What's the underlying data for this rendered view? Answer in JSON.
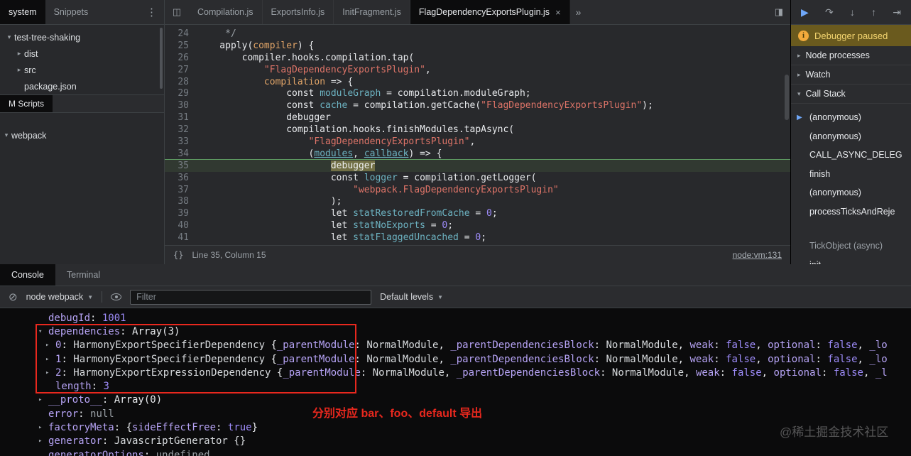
{
  "colors": {
    "annotation_red": "#e8281e",
    "accent_blue": "#6fa7f9",
    "paused_banner_bg": "#6a5a1e",
    "paused_banner_text": "#f4d570"
  },
  "left_pane": {
    "tabs": [
      {
        "label": "system",
        "active": true
      },
      {
        "label": "Snippets",
        "active": false
      }
    ],
    "tree": [
      {
        "label": "test-tree-shaking",
        "depth": 0,
        "expander": "down"
      },
      {
        "label": "dist",
        "depth": 1,
        "expander": "right"
      },
      {
        "label": "src",
        "depth": 1,
        "expander": "right"
      },
      {
        "label": "package.json",
        "depth": 1,
        "expander": "none"
      }
    ],
    "vm_scripts_header": "M Scripts",
    "vm_tree": [
      {
        "label": "webpack",
        "expander": "down"
      }
    ]
  },
  "editor": {
    "tabs": [
      {
        "label": "Compilation.js",
        "active": false
      },
      {
        "label": "ExportsInfo.js",
        "active": false
      },
      {
        "label": "InitFragment.js",
        "active": false
      },
      {
        "label": "FlagDependencyExportsPlugin.js",
        "active": true,
        "closable": true
      }
    ],
    "paused_line": 35,
    "status": {
      "format_icon": "{}",
      "position": "Line 35, Column 15",
      "source_link": "node:vm:131"
    },
    "code": [
      {
        "num": 24,
        "segs": [
          [
            "cmt",
            "     */"
          ]
        ]
      },
      {
        "num": 25,
        "segs": [
          [
            "pl",
            "    apply("
          ],
          [
            "def",
            "compiler"
          ],
          [
            "pl",
            ") {"
          ]
        ]
      },
      {
        "num": 26,
        "segs": [
          [
            "pl",
            "        compiler.hooks.compilation.tap("
          ]
        ]
      },
      {
        "num": 27,
        "segs": [
          [
            "str",
            "            \"FlagDependencyExportsPlugin\""
          ],
          [
            "pl",
            ","
          ]
        ]
      },
      {
        "num": 28,
        "segs": [
          [
            "pl",
            "            "
          ],
          [
            "def",
            "compilation"
          ],
          [
            "pl",
            " => {"
          ]
        ]
      },
      {
        "num": 29,
        "segs": [
          [
            "pl",
            "                const "
          ],
          [
            "var",
            "moduleGraph"
          ],
          [
            "pl",
            " = compilation.moduleGraph;"
          ]
        ]
      },
      {
        "num": 30,
        "segs": [
          [
            "pl",
            "                const "
          ],
          [
            "var",
            "cache"
          ],
          [
            "pl",
            " = compilation.getCache("
          ],
          [
            "str",
            "\"FlagDependencyExportsPlugin\""
          ],
          [
            "pl",
            ");"
          ]
        ]
      },
      {
        "num": 31,
        "segs": [
          [
            "pl",
            "                debugger"
          ]
        ]
      },
      {
        "num": 32,
        "segs": [
          [
            "pl",
            "                compilation.hooks.finishModules.tapAsync("
          ]
        ]
      },
      {
        "num": 33,
        "segs": [
          [
            "str",
            "                    \"FlagDependencyExportsPlugin\""
          ],
          [
            "pl",
            ","
          ]
        ]
      },
      {
        "num": 34,
        "segs": [
          [
            "pl",
            "                    ("
          ],
          [
            "varu",
            "modules"
          ],
          [
            "pl",
            ", "
          ],
          [
            "varu",
            "callback"
          ],
          [
            "pl",
            ") => {"
          ]
        ]
      },
      {
        "num": 35,
        "segs": [
          [
            "pl",
            "                        "
          ],
          [
            "dbg",
            "debugger"
          ]
        ]
      },
      {
        "num": 36,
        "segs": [
          [
            "pl",
            "                        const "
          ],
          [
            "var",
            "logger"
          ],
          [
            "pl",
            " = compilation.getLogger("
          ]
        ]
      },
      {
        "num": 37,
        "segs": [
          [
            "str",
            "                            \"webpack.FlagDependencyExportsPlugin\""
          ]
        ]
      },
      {
        "num": 38,
        "segs": [
          [
            "pl",
            "                        );"
          ]
        ]
      },
      {
        "num": 39,
        "segs": [
          [
            "pl",
            "                        let "
          ],
          [
            "var",
            "statRestoredFromCache"
          ],
          [
            "pl",
            " = "
          ],
          [
            "num",
            "0"
          ],
          [
            "pl",
            ";"
          ]
        ]
      },
      {
        "num": 40,
        "segs": [
          [
            "pl",
            "                        let "
          ],
          [
            "var",
            "statNoExports"
          ],
          [
            "pl",
            " = "
          ],
          [
            "num",
            "0"
          ],
          [
            "pl",
            ";"
          ]
        ]
      },
      {
        "num": 41,
        "segs": [
          [
            "pl",
            "                        let "
          ],
          [
            "var",
            "statFlaggedUncached"
          ],
          [
            "pl",
            " = "
          ],
          [
            "num",
            "0"
          ],
          [
            "pl",
            ";"
          ]
        ]
      }
    ]
  },
  "debugger_panel": {
    "controls": [
      "resume",
      "step-over",
      "step-into",
      "step-out",
      "step"
    ],
    "paused_banner": "Debugger paused",
    "sections": [
      {
        "label": "Node processes",
        "expanded": false
      },
      {
        "label": "Watch",
        "expanded": false
      },
      {
        "label": "Call Stack",
        "expanded": true
      }
    ],
    "call_stack": [
      {
        "label": "(anonymous)",
        "current": true
      },
      {
        "label": "(anonymous)"
      },
      {
        "label": "CALL_ASYNC_DELEG"
      },
      {
        "label": "finish"
      },
      {
        "label": "(anonymous)"
      },
      {
        "label": "processTicksAndReje"
      },
      {
        "label": "TickObject (async)",
        "async": true
      },
      {
        "label": "init"
      }
    ]
  },
  "console": {
    "tabs": [
      {
        "label": "Console",
        "active": true
      },
      {
        "label": "Terminal",
        "active": false
      }
    ],
    "toolbar": {
      "context_select": "node webpack",
      "filter_placeholder": "Filter",
      "levels_select": "Default levels"
    },
    "rows": [
      {
        "indent": 1,
        "arrow": "none",
        "segs": [
          [
            "key",
            "debugId"
          ],
          [
            "pl",
            ": "
          ],
          [
            "num",
            "1001"
          ]
        ]
      },
      {
        "indent": 1,
        "arrow": "down",
        "segs": [
          [
            "key",
            "dependencies"
          ],
          [
            "pl",
            ": "
          ],
          [
            "pl",
            "Array(3)"
          ]
        ]
      },
      {
        "indent": 2,
        "arrow": "right",
        "segs": [
          [
            "key",
            "0"
          ],
          [
            "pl",
            ": "
          ],
          [
            "cls",
            "HarmonyExportSpecifierDependency"
          ],
          [
            "pl",
            " {"
          ],
          [
            "key",
            "_parentModule"
          ],
          [
            "pl",
            ": "
          ],
          [
            "cls",
            "NormalModule"
          ],
          [
            "pl",
            ", "
          ],
          [
            "key",
            "_parentDependenciesBlock"
          ],
          [
            "pl",
            ": "
          ],
          [
            "cls",
            "NormalModule"
          ],
          [
            "pl",
            ", "
          ],
          [
            "key",
            "weak"
          ],
          [
            "pl",
            ": "
          ],
          [
            "num",
            "false"
          ],
          [
            "pl",
            ", "
          ],
          [
            "key",
            "optional"
          ],
          [
            "pl",
            ": "
          ],
          [
            "num",
            "false"
          ],
          [
            "pl",
            ", "
          ],
          [
            "key",
            "_lo"
          ]
        ]
      },
      {
        "indent": 2,
        "arrow": "right",
        "segs": [
          [
            "key",
            "1"
          ],
          [
            "pl",
            ": "
          ],
          [
            "cls",
            "HarmonyExportSpecifierDependency"
          ],
          [
            "pl",
            " {"
          ],
          [
            "key",
            "_parentModule"
          ],
          [
            "pl",
            ": "
          ],
          [
            "cls",
            "NormalModule"
          ],
          [
            "pl",
            ", "
          ],
          [
            "key",
            "_parentDependenciesBlock"
          ],
          [
            "pl",
            ": "
          ],
          [
            "cls",
            "NormalModule"
          ],
          [
            "pl",
            ", "
          ],
          [
            "key",
            "weak"
          ],
          [
            "pl",
            ": "
          ],
          [
            "num",
            "false"
          ],
          [
            "pl",
            ", "
          ],
          [
            "key",
            "optional"
          ],
          [
            "pl",
            ": "
          ],
          [
            "num",
            "false"
          ],
          [
            "pl",
            ", "
          ],
          [
            "key",
            "_lo"
          ]
        ]
      },
      {
        "indent": 2,
        "arrow": "right",
        "segs": [
          [
            "key",
            "2"
          ],
          [
            "pl",
            ": "
          ],
          [
            "cls",
            "HarmonyExportExpressionDependency"
          ],
          [
            "pl",
            " {"
          ],
          [
            "key",
            "_parentModule"
          ],
          [
            "pl",
            ": "
          ],
          [
            "cls",
            "NormalModule"
          ],
          [
            "pl",
            ", "
          ],
          [
            "key",
            "_parentDependenciesBlock"
          ],
          [
            "pl",
            ": "
          ],
          [
            "cls",
            "NormalModule"
          ],
          [
            "pl",
            ", "
          ],
          [
            "key",
            "weak"
          ],
          [
            "pl",
            ": "
          ],
          [
            "num",
            "false"
          ],
          [
            "pl",
            ", "
          ],
          [
            "key",
            "optional"
          ],
          [
            "pl",
            ": "
          ],
          [
            "num",
            "false"
          ],
          [
            "pl",
            ", "
          ],
          [
            "key",
            "_l"
          ]
        ]
      },
      {
        "indent": 2,
        "arrow": "none",
        "segs": [
          [
            "key",
            "length"
          ],
          [
            "pl",
            ": "
          ],
          [
            "num",
            "3"
          ]
        ]
      },
      {
        "indent": 1,
        "arrow": "right",
        "segs": [
          [
            "key",
            "__proto__"
          ],
          [
            "pl",
            ": "
          ],
          [
            "pl",
            "Array(0)"
          ]
        ]
      },
      {
        "indent": 1,
        "arrow": "none",
        "segs": [
          [
            "key",
            "error"
          ],
          [
            "pl",
            ": "
          ],
          [
            "nul",
            "null"
          ]
        ]
      },
      {
        "indent": 1,
        "arrow": "right",
        "segs": [
          [
            "key",
            "factoryMeta"
          ],
          [
            "pl",
            ": "
          ],
          [
            "pl",
            "{"
          ],
          [
            "key",
            "sideEffectFree"
          ],
          [
            "pl",
            ": "
          ],
          [
            "num",
            "true"
          ],
          [
            "pl",
            "}"
          ]
        ]
      },
      {
        "indent": 1,
        "arrow": "right",
        "segs": [
          [
            "key",
            "generator"
          ],
          [
            "pl",
            ": "
          ],
          [
            "cls",
            "JavascriptGenerator {}"
          ]
        ]
      },
      {
        "indent": 1,
        "arrow": "none",
        "segs": [
          [
            "key",
            "generatorOptions"
          ],
          [
            "pl",
            ": "
          ],
          [
            "nul",
            "undefined"
          ]
        ]
      }
    ],
    "annotation": {
      "text": "分别对应 bar、foo、default 导出"
    },
    "watermark": "@稀土掘金技术社区"
  }
}
